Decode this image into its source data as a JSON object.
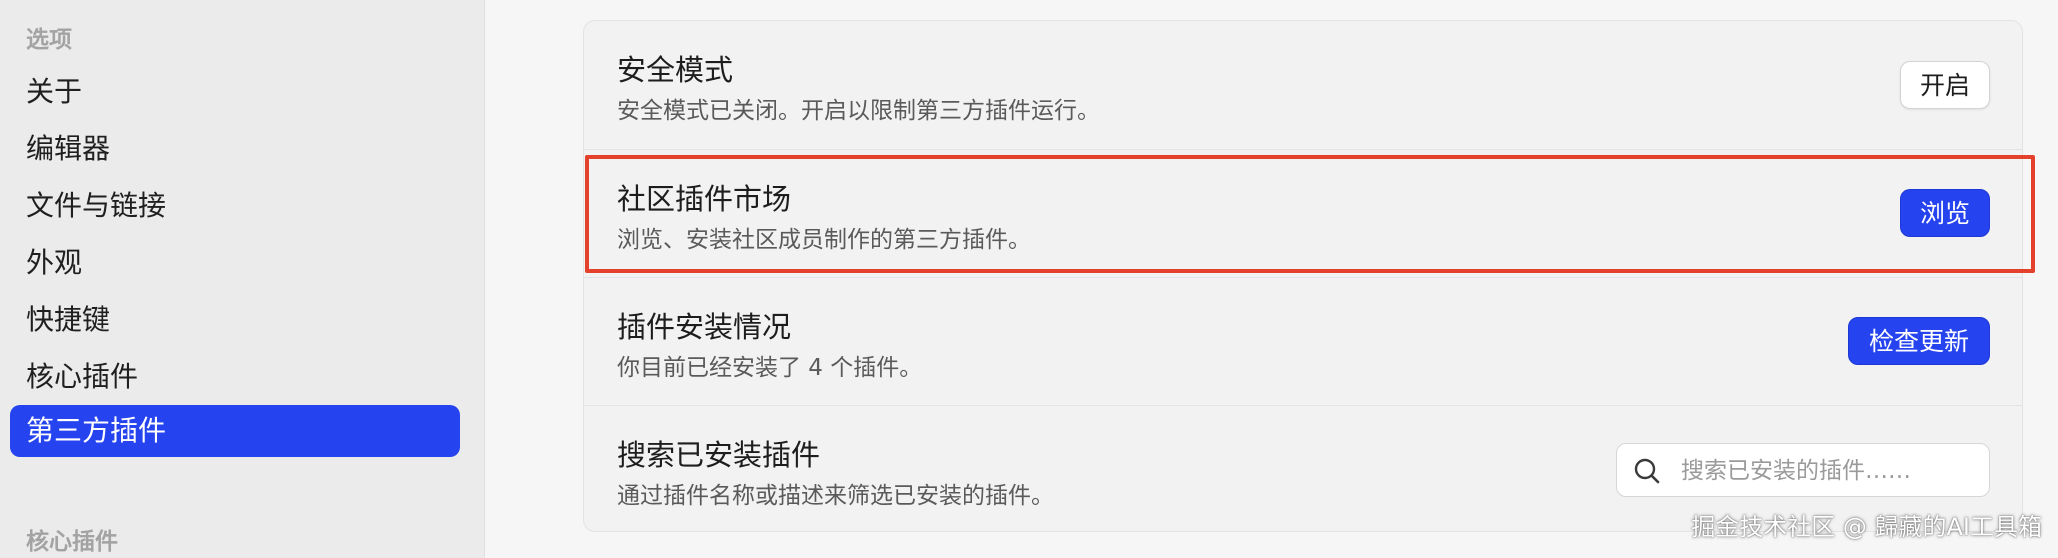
{
  "sidebar": {
    "options_heading": "选项",
    "items": [
      {
        "label": "关于"
      },
      {
        "label": "编辑器"
      },
      {
        "label": "文件与链接"
      },
      {
        "label": "外观"
      },
      {
        "label": "快捷键"
      },
      {
        "label": "核心插件"
      },
      {
        "label": "第三方插件",
        "active": true
      }
    ],
    "core_plugins_heading": "核心插件"
  },
  "settings": {
    "safe_mode": {
      "title": "安全模式",
      "description": "安全模式已关闭。开启以限制第三方插件运行。",
      "button_label": "开启"
    },
    "community_market": {
      "title": "社区插件市场",
      "description": "浏览、安装社区成员制作的第三方插件。",
      "button_label": "浏览"
    },
    "install_status": {
      "title": "插件安装情况",
      "description": "你目前已经安装了 4 个插件。",
      "button_label": "检查更新"
    },
    "search_installed": {
      "title": "搜索已安装插件",
      "description": "通过插件名称或描述来筛选已安装的插件。",
      "search_placeholder": "搜索已安装的插件……",
      "search_value": ""
    }
  },
  "watermark": "掘金技术社区 @ 歸藏的AI工具箱",
  "colors": {
    "accent": "#2544f0",
    "highlight_border": "#e3412c"
  },
  "icons": {
    "search": "search-icon"
  }
}
